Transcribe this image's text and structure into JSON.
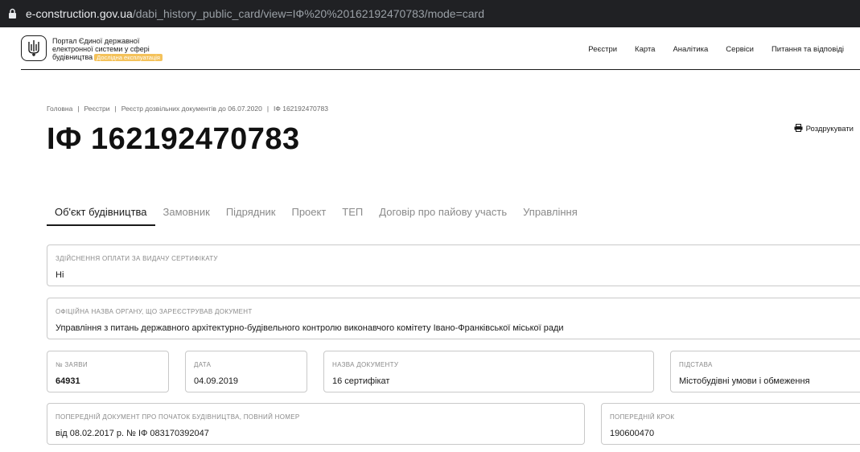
{
  "browser": {
    "url_host": "e-construction.gov.ua",
    "url_path": "/dabi_history_public_card/view=ІФ%20%20162192470783/mode=card"
  },
  "header": {
    "portal_line1": "Портал Єдиної державної",
    "portal_line2": "електронної системи у сфері",
    "portal_line3": "будівництва",
    "badge": "Дослідна експлуатація",
    "nav": [
      "Реєстри",
      "Карта",
      "Аналітика",
      "Сервіси",
      "Питання та відповіді"
    ]
  },
  "breadcrumb": [
    "Головна",
    "Реєстри",
    "Реєстр дозвільних документів до 06.07.2020",
    "ІФ 162192470783"
  ],
  "page_title": "ІФ 162192470783",
  "print_label": "Роздрукувати",
  "tabs": [
    "Об'єкт будівництва",
    "Замовник",
    "Підрядник",
    "Проект",
    "ТЕП",
    "Договір про пайову участь",
    "Управління"
  ],
  "fields": {
    "payment": {
      "label": "Здійснення оплати за видачу сертифікату",
      "value": "Ні"
    },
    "authority": {
      "label": "Офіційна назва органу, що зареєстрував документ",
      "value": "Управління з питань державного архітектурно-будівельного контролю виконавчого комітету Івано-Франківської міської ради"
    },
    "app_no": {
      "label": "№ заяви",
      "value": "64931"
    },
    "date": {
      "label": "Дата",
      "value": "04.09.2019"
    },
    "doc_name": {
      "label": "Назва документу",
      "value": "16 сертифікат"
    },
    "basis": {
      "label": "Підстава",
      "value": "Містобудівні умови і обмеження"
    },
    "prev_doc": {
      "label": "Попередній документ про початок будівництва, повний номер",
      "value": "від 08.02.2017 р. № ІФ 083170392047"
    },
    "prev_step": {
      "label": "Попередній крок",
      "value": "190600470"
    }
  }
}
